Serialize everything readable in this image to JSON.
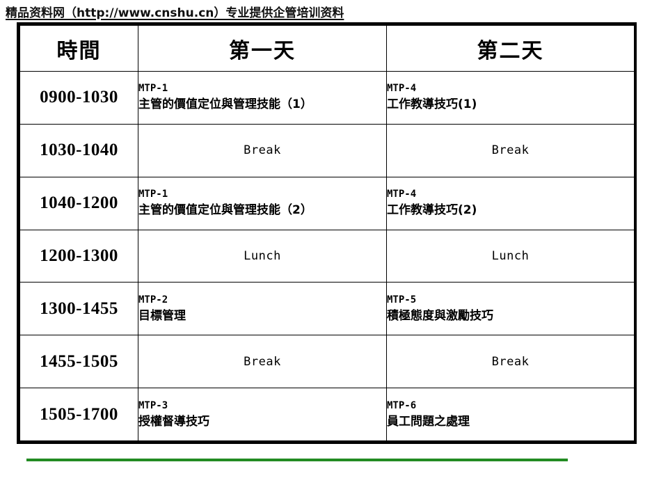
{
  "watermark": {
    "text": "精品资料网（http://www.cnshu.cn）专业提供企管培训资料"
  },
  "table": {
    "columns": [
      "時間",
      "第一天",
      "第二天"
    ],
    "rows": [
      {
        "time": "0900-1030",
        "type": "session",
        "day1": {
          "code": "MTP-1",
          "title": "主管的價值定位與管理技能（1）"
        },
        "day2": {
          "code": "MTP-4",
          "title": "工作教導技巧(1)"
        }
      },
      {
        "time": "1030-1040",
        "type": "break",
        "day1": {
          "code": "",
          "title": "Break"
        },
        "day2": {
          "code": "",
          "title": "Break"
        }
      },
      {
        "time": "1040-1200",
        "type": "session",
        "day1": {
          "code": "MTP-1",
          "title": "主管的價值定位與管理技能（2）"
        },
        "day2": {
          "code": "MTP-4",
          "title": "工作教導技巧(2)"
        }
      },
      {
        "time": "1200-1300",
        "type": "break",
        "day1": {
          "code": "",
          "title": "Lunch"
        },
        "day2": {
          "code": "",
          "title": "Lunch"
        }
      },
      {
        "time": "1300-1455",
        "type": "session",
        "day1": {
          "code": "MTP-2",
          "title": "目標管理"
        },
        "day2": {
          "code": "MTP-5",
          "title": "積極態度與激勵技巧"
        }
      },
      {
        "time": "1455-1505",
        "type": "break",
        "day1": {
          "code": "",
          "title": "Break"
        },
        "day2": {
          "code": "",
          "title": "Break"
        }
      },
      {
        "time": "1505-1700",
        "type": "session",
        "day1": {
          "code": "MTP-3",
          "title": "授權督導技巧"
        },
        "day2": {
          "code": "MTP-6",
          "title": "員工問題之處理"
        }
      }
    ]
  },
  "footer": {
    "rule_color": "#228B22"
  }
}
